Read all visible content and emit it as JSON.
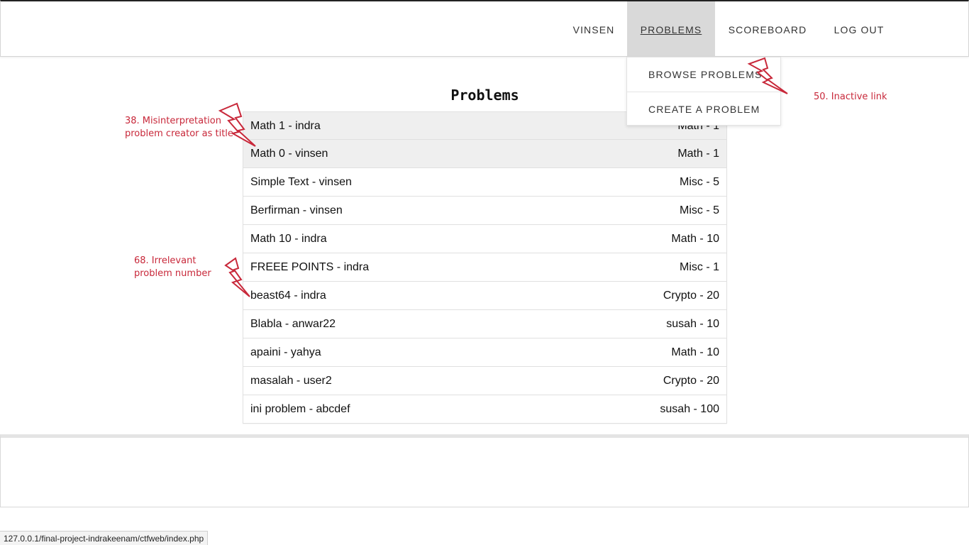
{
  "navbar": {
    "items": [
      {
        "label": "VINSEN"
      },
      {
        "label": "PROBLEMS"
      },
      {
        "label": "SCOREBOARD"
      },
      {
        "label": "LOG OUT"
      }
    ],
    "dropdown": {
      "items": [
        {
          "label": "BROWSE PROBLEMS"
        },
        {
          "label": "CREATE A PROBLEM"
        }
      ]
    }
  },
  "main": {
    "title": "Problems",
    "problems": [
      {
        "title": "Math 1 - indra",
        "meta": "Math - 1",
        "solved": true
      },
      {
        "title": "Math 0 - vinsen",
        "meta": "Math - 1",
        "solved": true
      },
      {
        "title": "Simple Text - vinsen",
        "meta": "Misc - 5",
        "solved": false
      },
      {
        "title": "Berfirman - vinsen",
        "meta": "Misc - 5",
        "solved": false
      },
      {
        "title": "Math 10 - indra",
        "meta": "Math - 10",
        "solved": false
      },
      {
        "title": "FREEE POINTS - indra",
        "meta": "Misc - 1",
        "solved": false
      },
      {
        "title": "beast64 - indra",
        "meta": "Crypto - 20",
        "solved": false
      },
      {
        "title": "Blabla - anwar22",
        "meta": "susah - 10",
        "solved": false
      },
      {
        "title": "apaini - yahya",
        "meta": "Math - 10",
        "solved": false
      },
      {
        "title": "masalah - user2",
        "meta": "Crypto - 20",
        "solved": false
      },
      {
        "title": "ini problem - abcdef",
        "meta": "susah - 100",
        "solved": false
      }
    ]
  },
  "status_bar": {
    "url": "127.0.0.1/final-project-indrakeenam/ctfweb/index.php"
  },
  "annotations": [
    {
      "line1": "38. Misinterpretation",
      "line2": "problem creator as title"
    },
    {
      "line1": "68. Irrelevant",
      "line2": "problem number"
    },
    {
      "line1": "50. Inactive link"
    }
  ],
  "colors": {
    "annotation": "#c8283a",
    "active_nav_bg": "#d9d9d9",
    "solved_row_bg": "#efefef"
  },
  "icons": [
    "lightning-bolt-icon"
  ]
}
